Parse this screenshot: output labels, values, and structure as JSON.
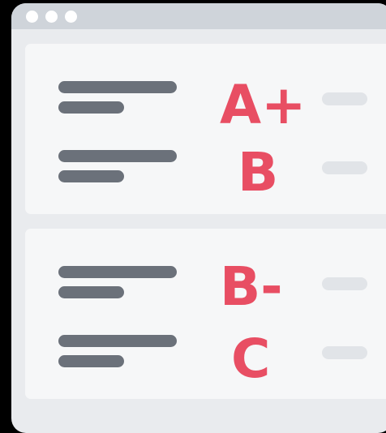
{
  "window": {
    "controls": [
      "window-dot",
      "window-dot",
      "window-dot"
    ]
  },
  "cards": [
    {
      "rows": [
        {
          "grade": "A+"
        },
        {
          "grade": "B"
        }
      ]
    },
    {
      "rows": [
        {
          "grade": "B-"
        },
        {
          "grade": "C"
        }
      ]
    }
  ],
  "colors": {
    "frame": "#E9EBEE",
    "titlebar": "#CFD4DA",
    "card": "#F6F7F8",
    "text_line": "#6B717A",
    "grade_red": "#E84E63",
    "placeholder_pill": "#E1E4E8"
  }
}
